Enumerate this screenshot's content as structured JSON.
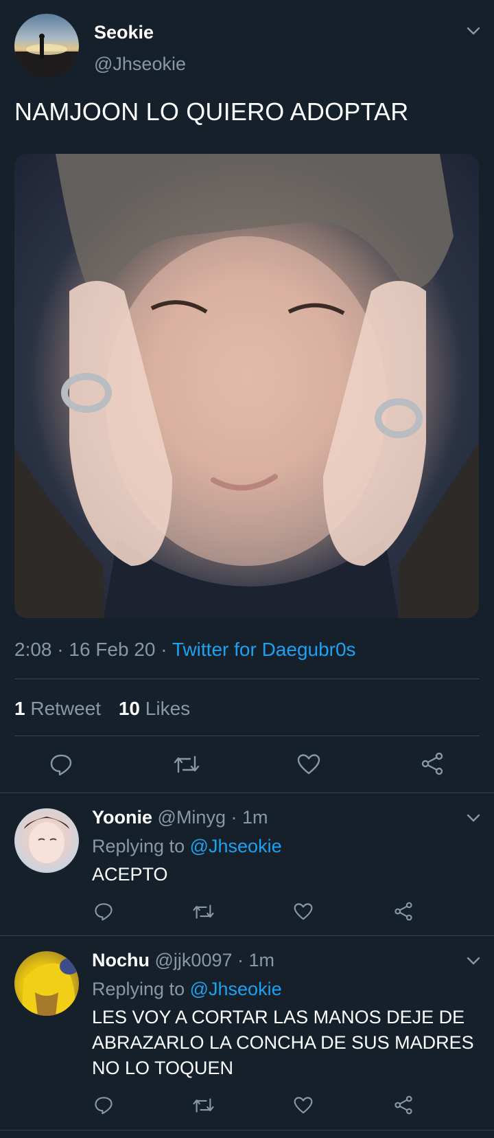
{
  "tweet": {
    "author_name": "Seokie",
    "author_handle": "@Jhseokie",
    "text": "NAMJOON LO QUIERO ADOPTAR",
    "time": "2:08",
    "date": "16 Feb 20",
    "separator": "·",
    "source": "Twitter for Daegubr0s",
    "retweets_count": "1",
    "retweets_label": "Retweet",
    "likes_count": "10",
    "likes_label": "Likes"
  },
  "replies": [
    {
      "name": "Yoonie",
      "handle": "@Minyg",
      "time": "· 1m",
      "replying_prefix": "Replying to",
      "replying_to": "@Jhseokie",
      "text": "ACEPTO"
    },
    {
      "name": "Nochu",
      "handle": "@jjk0097",
      "time": "· 1m",
      "replying_prefix": "Replying to",
      "replying_to": "@Jhseokie",
      "text_lines": [
        "LES VOY A CORTAR LAS MANOS DEJE DE",
        "ABRAZARLO LA CONCHA DE SUS MADRES",
        "NO LO TOQUEN"
      ]
    }
  ],
  "icons": {
    "reply": "reply-icon",
    "retweet": "retweet-icon",
    "like": "heart-icon",
    "share": "share-icon",
    "more": "chevron-down-icon"
  },
  "colors": {
    "background": "#15202b",
    "accent": "#1da1f2",
    "muted": "#8899a6",
    "divider": "#38444d"
  }
}
